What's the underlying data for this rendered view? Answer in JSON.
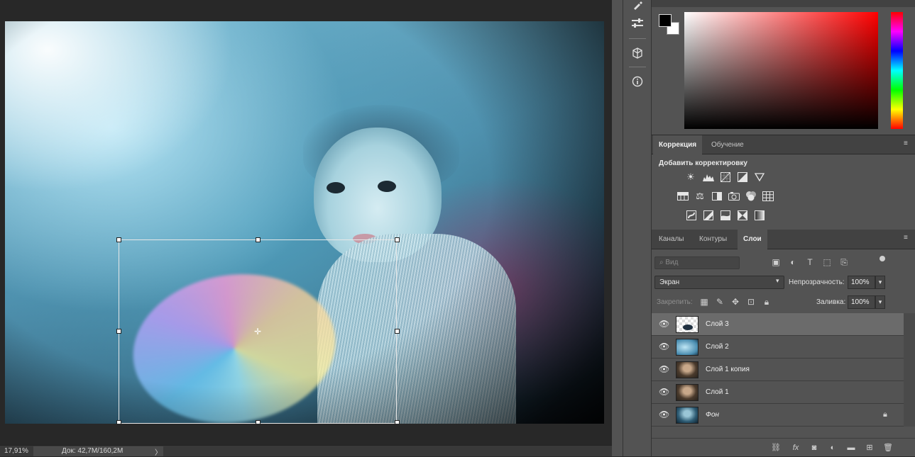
{
  "status": {
    "zoom": "17,91%",
    "doc_info": "Док: 42,7M/160,2M",
    "arrow": "〉"
  },
  "toolstrip": {
    "icons": [
      "brush-settings-icon",
      "properties-icon",
      "3d-icon",
      "info-icon"
    ]
  },
  "color": {
    "foreground": "#000000",
    "background": "#ffffff",
    "hue": "#ff0000"
  },
  "adjustments_panel": {
    "tabs": [
      {
        "label": "Коррекция",
        "active": true
      },
      {
        "label": "Обучение",
        "active": false
      }
    ],
    "title": "Добавить корректировку"
  },
  "layers_panel": {
    "tabs": [
      {
        "label": "Каналы",
        "active": false
      },
      {
        "label": "Контуры",
        "active": false
      },
      {
        "label": "Слои",
        "active": true
      }
    ],
    "filter_placeholder": "Вид",
    "blend_mode": "Экран",
    "opacity_label": "Непрозрачность:",
    "opacity_value": "100%",
    "lock_label": "Закрепить:",
    "fill_label": "Заливка:",
    "fill_value": "100%",
    "layers": [
      {
        "name": "Слой 3",
        "selected": true,
        "visible": true
      },
      {
        "name": "Слой 2",
        "selected": false,
        "visible": true
      },
      {
        "name": "Слой 1 копия",
        "selected": false,
        "visible": true
      },
      {
        "name": "Слой 1",
        "selected": false,
        "visible": true
      },
      {
        "name": "Фон",
        "selected": false,
        "visible": true,
        "locked": true
      }
    ]
  }
}
